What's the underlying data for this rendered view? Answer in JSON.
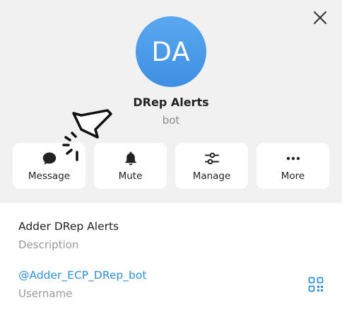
{
  "profile": {
    "initials": "DA",
    "name": "DRep Alerts",
    "subtitle": "bot",
    "avatar_color": "#4a9ae8"
  },
  "actions": [
    {
      "label": "Message",
      "icon": "chat-bubble-icon"
    },
    {
      "label": "Mute",
      "icon": "bell-icon"
    },
    {
      "label": "Manage",
      "icon": "sliders-icon"
    },
    {
      "label": "More",
      "icon": "dots-horizontal-icon"
    }
  ],
  "info": {
    "description_value": "Adder DRep Alerts",
    "description_label": "Description",
    "username_value": "@Adder_ECP_DRep_bot",
    "username_label": "Username"
  },
  "colors": {
    "header_bg": "#f1f1f1",
    "link": "#2f8fd6",
    "muted_text": "#8e8e8e"
  },
  "icons": {
    "close": "close-icon",
    "qr": "qr-code-icon",
    "cursor": "click-cursor-icon"
  }
}
